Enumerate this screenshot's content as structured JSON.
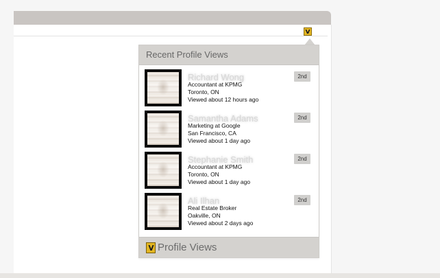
{
  "header": {
    "title": "Recent Profile Views"
  },
  "profiles": [
    {
      "name": "Richard Wong",
      "title": "Accountant at KPMG",
      "location": "Toronto, ON",
      "viewed": "Viewed about 12 hours ago",
      "degree": "2nd"
    },
    {
      "name": "Samantha Adams",
      "title": "Marketing at Google",
      "location": "San Francisco, CA",
      "viewed": "Viewed about 1 day ago",
      "degree": "2nd"
    },
    {
      "name": "Stephanie Smith",
      "title": "Accountant at KPMG",
      "location": "Toronto, ON",
      "viewed": "Viewed about 1 day ago",
      "degree": "2nd"
    },
    {
      "name": "Ali Ilhan",
      "title": "Real Estate Broker",
      "location": "Oakville, ON",
      "viewed": "Viewed about 2 days ago",
      "degree": "2nd"
    }
  ],
  "footer": {
    "label": "Profile Views",
    "logo_icon": "eye-logo-icon"
  },
  "toolbar": {
    "extension_icon": "eye-logo-icon"
  },
  "colors": {
    "accent": "#e3b622",
    "panel_header": "#d4d2cf",
    "badge": "#d0cfcd"
  }
}
